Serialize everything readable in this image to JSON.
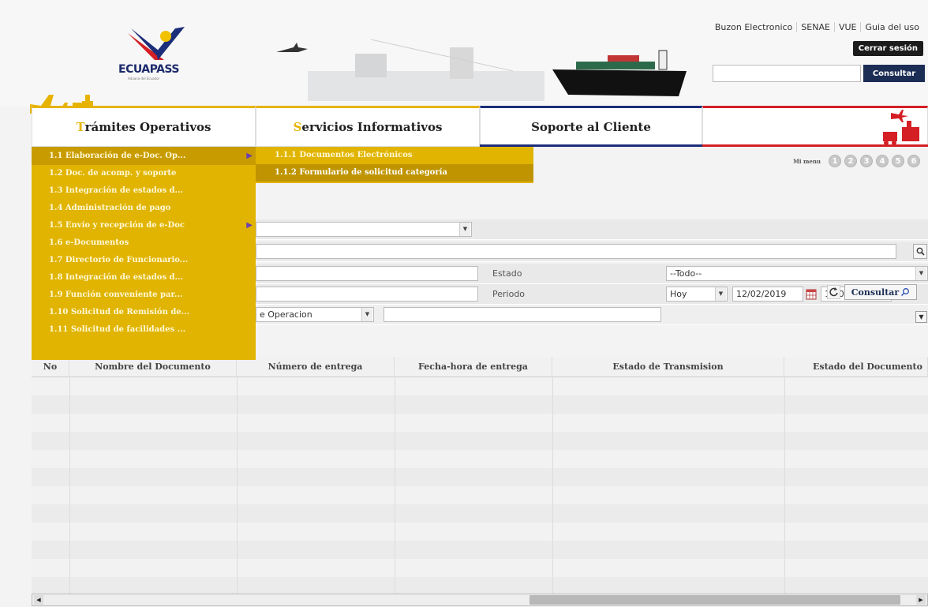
{
  "header": {
    "logo_text": "ECUAPASS",
    "logo_subtext": "Aduana del Ecuador",
    "top_links": [
      "Buzon Electronico",
      "SENAE",
      "VUE",
      "Guia del uso"
    ],
    "logout_label": "Cerrar sesión",
    "search_value": "",
    "search_button": "Consultar"
  },
  "nav": {
    "tabs": [
      {
        "cap": "T",
        "rest": "rámites Operativos"
      },
      {
        "cap": "S",
        "rest": "ervicios Informativos"
      },
      {
        "cap": "",
        "rest": "Soporte al Cliente"
      }
    ]
  },
  "menu": {
    "level1": [
      "1.1 Elaboración de e-Doc. Op...",
      "1.2 Doc. de acomp. y soporte",
      "1.3 Integración de estados d...",
      "1.4 Administración de pago",
      "1.5 Envío y recepción de e-Doc",
      "1.6 e-Documentos",
      "1.7 Directorio de Funcionario...",
      "1.8 Integración de estados d...",
      "1.9 Función conveniente par...",
      "1.10 Solicitud de Remisión de...",
      "1.11 Solicitud de facilidades ..."
    ],
    "level2": [
      "1.1.1 Documentos Electrónicos",
      "1.1.2 Formulario de solicitud categoría"
    ]
  },
  "mi_menu": {
    "label": "Mi menu",
    "numbers": [
      "1",
      "2",
      "3",
      "4",
      "5",
      "6"
    ]
  },
  "filters": {
    "estado_label": "Estado",
    "estado_value": "--Todo--",
    "periodo_label": "Periodo",
    "periodo_value": "Hoy",
    "date_from": "12/02/2019",
    "date_to": "12/02/2019",
    "operacion_value": "e Operacion",
    "consultar_label": "Consultar"
  },
  "table": {
    "columns": [
      "No",
      "Nombre del Documento",
      "Número de entrega",
      "Fecha-hora de entrega",
      "Estado de Transmision",
      "Estado del Documento"
    ]
  },
  "colors": {
    "menu_gold": "#e0b400",
    "menu_selected": "#c89c00",
    "brand_blue": "#1c2d7a",
    "brand_red": "#d41f25",
    "dark_button": "#1c2d55"
  }
}
